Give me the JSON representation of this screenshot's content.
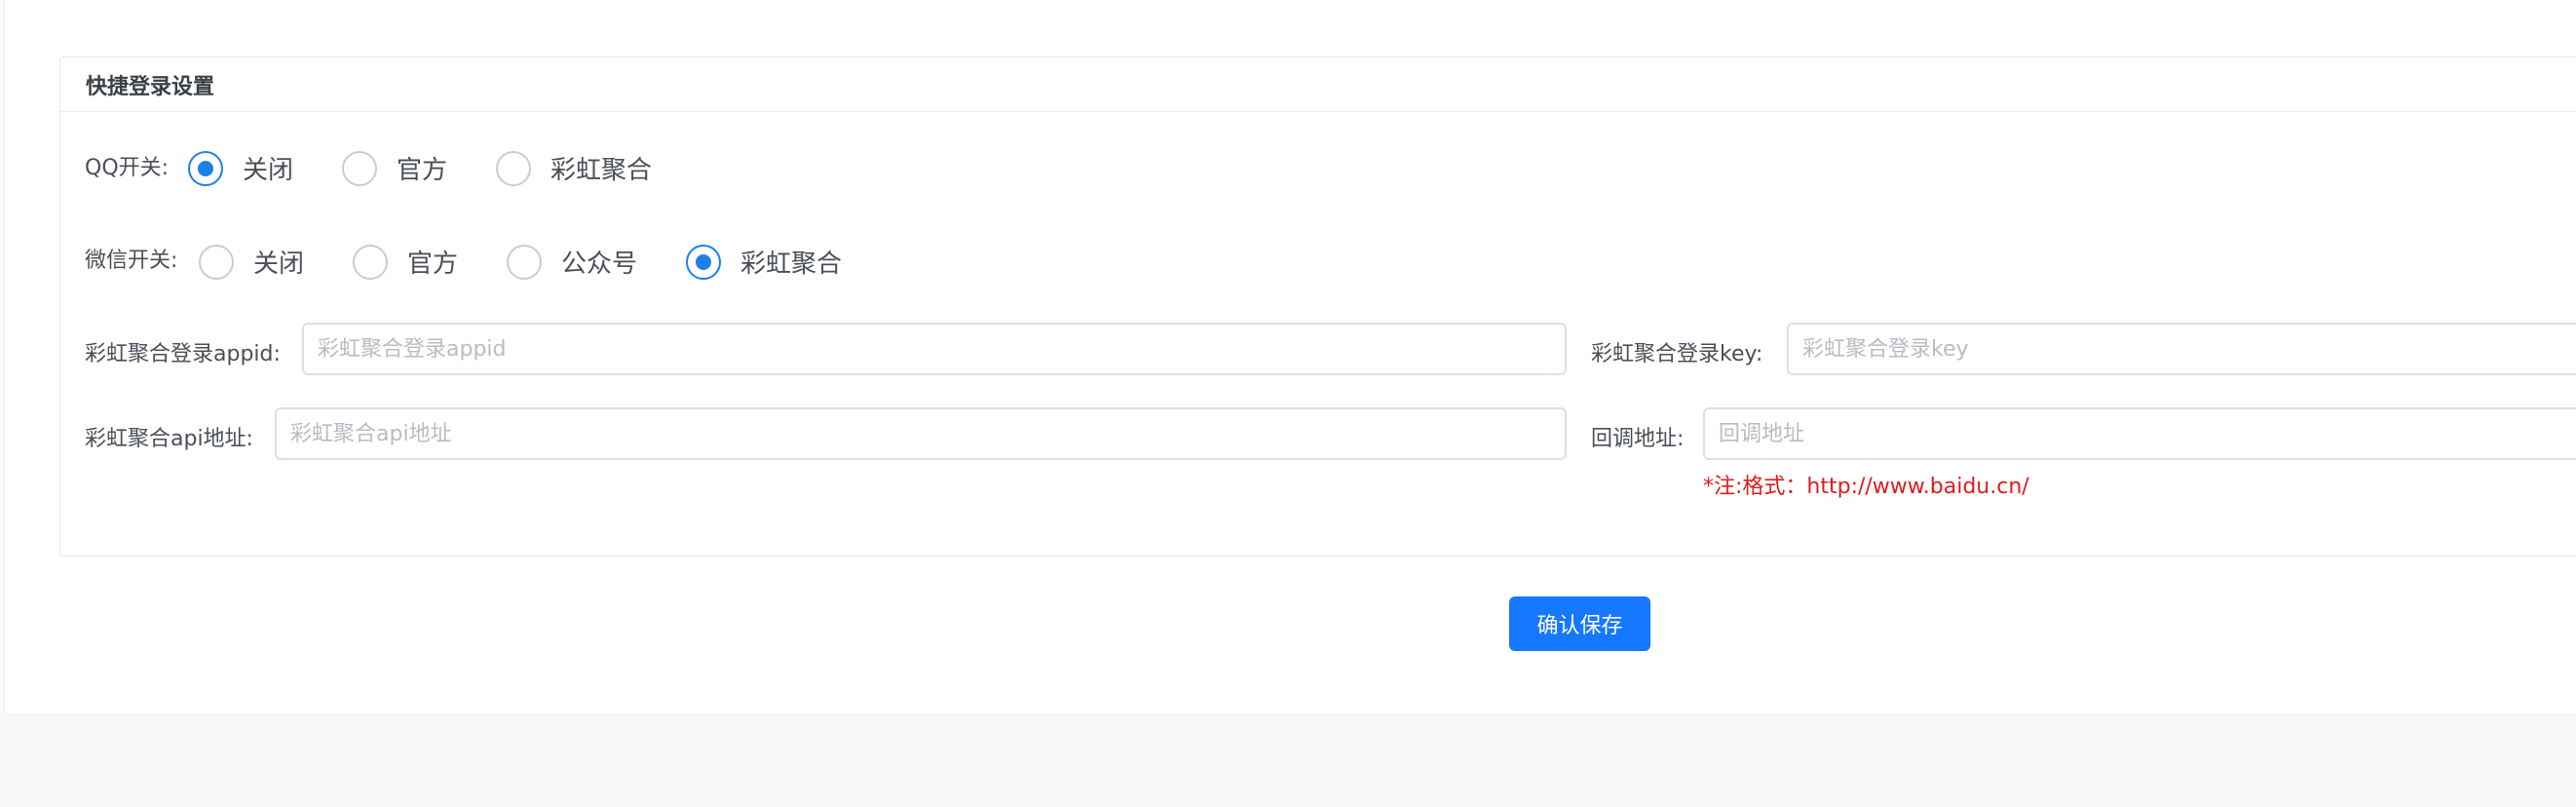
{
  "panel": {
    "title": "快捷登录设置"
  },
  "qq_switch": {
    "label": "QQ开关:",
    "options": [
      "关闭",
      "官方",
      "彩虹聚合"
    ],
    "selected": "关闭"
  },
  "wechat_switch": {
    "label": "微信开关:",
    "options": [
      "关闭",
      "官方",
      "公众号",
      "彩虹聚合"
    ],
    "selected": "彩虹聚合"
  },
  "fields": {
    "appid": {
      "label": "彩虹聚合登录appid:",
      "placeholder": "彩虹聚合登录appid",
      "value": ""
    },
    "key": {
      "label": "彩虹聚合登录key:",
      "placeholder": "彩虹聚合登录key",
      "value": ""
    },
    "api_url": {
      "label": "彩虹聚合api地址:",
      "placeholder": "彩虹聚合api地址",
      "value": ""
    },
    "callback": {
      "label": "回调地址:",
      "placeholder": "回调地址",
      "value": ""
    }
  },
  "callback_note": "*注:格式：http://www.baidu.cn/",
  "save_button_label": "确认保存",
  "colors": {
    "accent": "#1677ff",
    "note_red": "#e01b1b"
  }
}
